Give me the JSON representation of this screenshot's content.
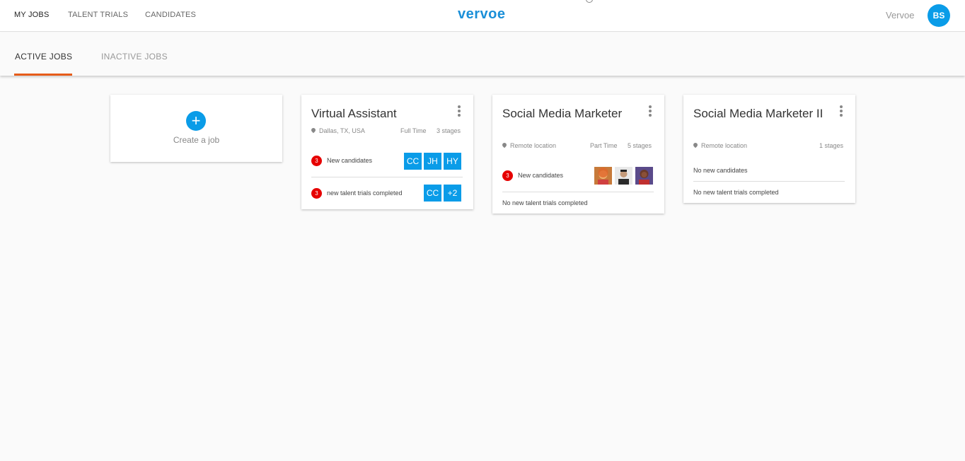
{
  "nav": {
    "items": [
      {
        "label": "MY JOBS",
        "active": true
      },
      {
        "label": "TALENT TRIALS",
        "active": false
      },
      {
        "label": "CANDIDATES",
        "active": false
      }
    ],
    "logo": "vervoe",
    "org_name": "Vervoe",
    "user_initials": "BS"
  },
  "tabs": [
    {
      "label": "ACTIVE JOBS",
      "active": true
    },
    {
      "label": "INACTIVE JOBS",
      "active": false
    }
  ],
  "create_card": {
    "label": "Create a job",
    "icon": "plus-icon"
  },
  "jobs": [
    {
      "title": "Virtual Assistant",
      "location": "Dallas, TX, USA",
      "type": "Full Time",
      "stages": "3 stages",
      "new_candidates": {
        "count": "3",
        "label": "New candidates",
        "chips": [
          "CC",
          "JH",
          "HY"
        ]
      },
      "talent_trials": {
        "count": "3",
        "label": "new talent trials completed",
        "chips": [
          "CC",
          "+2"
        ]
      }
    },
    {
      "title": "Social Media Marketer",
      "location": "Remote location",
      "type": "Part Time",
      "stages": "5 stages",
      "new_candidates": {
        "count": "3",
        "label": "New candidates",
        "photos": [
          "candidate-photo-1",
          "candidate-photo-2",
          "candidate-photo-3"
        ]
      },
      "talent_trials": {
        "label": "No new talent trials completed"
      }
    },
    {
      "title": "Social Media Marketer II",
      "location": "Remote location",
      "stages": "1 stages",
      "new_candidates": {
        "label": "No new candidates"
      },
      "talent_trials": {
        "label": "No new talent trials completed"
      }
    }
  ],
  "colors": {
    "accent": "#0a9ce8",
    "tab_indicator": "#e65c1a",
    "badge": "#e60000",
    "logo": "#1a8fd8"
  }
}
